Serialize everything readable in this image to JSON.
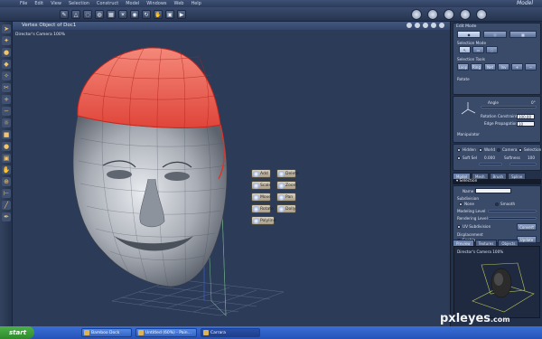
{
  "menubar": {
    "items": [
      "File",
      "Edit",
      "View",
      "Selection",
      "Construct",
      "Model",
      "Windows",
      "Web",
      "Help"
    ],
    "room": "Model"
  },
  "toolbar": {
    "tool_icons": [
      "paint-brush-icon",
      "polygon-icon",
      "lasso-icon",
      "globe-icon",
      "grid-icon",
      "light-icon",
      "eye-icon",
      "rotate-icon",
      "hand-icon",
      "camera-icon"
    ],
    "room_icons": [
      "sphere-icon",
      "sphere-icon",
      "sphere-icon",
      "sphere-icon",
      "sphere-icon"
    ]
  },
  "viewport": {
    "title": "Vertex Object of Doc1",
    "camera": "Director's Camera 100%"
  },
  "palette": {
    "add": "Add",
    "delete": "Delete",
    "scale": "Scale",
    "zoom": "Zoom",
    "move": "Move",
    "pan": "Pan",
    "rotate": "Rotate",
    "dolly": "Dolly",
    "polyline": "Polyline"
  },
  "panel": {
    "edit_mode_label": "Edit Mode",
    "selection_mode_label": "Selection Mode",
    "selection_tools_label": "Selection Tools",
    "selection_tools": [
      "Loop",
      "Ring",
      "Net",
      "Inv"
    ],
    "rotate_label": "Rotate",
    "angle_label": "Angle",
    "angle_value": "0°",
    "rotation_constraint_label": "Rotation Constraint",
    "rotation_constraint_value": "100.00",
    "edge_propagation_label": "Edge Propagation",
    "edge_propagation_value": "10",
    "manipulator_label": "Manipulator",
    "manipulator_options": [
      "Hidden",
      "World",
      "Camera",
      "Selection"
    ],
    "soft_sel_label": "Soft Sel",
    "soft_sel_value": "0.000",
    "softness_label": "Softness",
    "softness_value": "100",
    "tabs": [
      "Model",
      "Mesh",
      "Brush",
      "Spline"
    ],
    "selection_bar": "Selection",
    "name_label": "Name",
    "subdivision_label": "Subdivision",
    "subdivision_options": [
      "None",
      "Smooth"
    ],
    "modeling_level_label": "Modeling Level",
    "rendering_level_label": "Rendering Level",
    "uv_subdivision_label": "UV Subdivision",
    "convert_label": "Convert",
    "displacement_label": "Displacement",
    "enable_label": "Enable",
    "update_label": "Update",
    "preview_tabs": [
      "Preview",
      "Textures",
      "Objects"
    ],
    "preview_camera": "Director's Camera 100%"
  },
  "taskbar": {
    "start": "start",
    "tasks": [
      "Bamboo Dock",
      "Untitled (60%) - Pain...",
      "Carrara"
    ]
  },
  "watermark": {
    "name": "pxleyes",
    "tld": ".com"
  }
}
